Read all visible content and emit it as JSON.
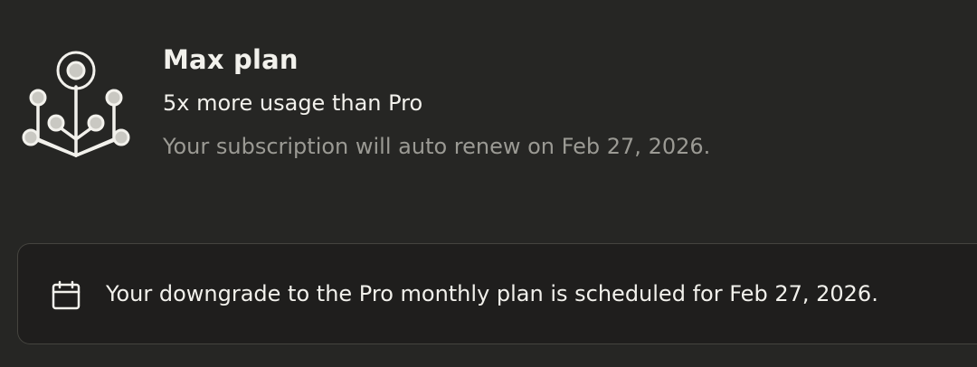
{
  "plan": {
    "icon": "plan-tree-icon",
    "title": "Max plan",
    "subtitle": "5x more usage than Pro",
    "renewal_text": "Your subscription will auto renew on Feb 27, 2026."
  },
  "notice": {
    "icon": "calendar-icon",
    "text": "Your downgrade to the Pro monthly plan is scheduled for Feb 27, 2026."
  },
  "colors": {
    "background": "#262624",
    "panel": "#1f1e1d",
    "text_primary": "#f2f1ec",
    "text_secondary": "#9b9a94"
  }
}
